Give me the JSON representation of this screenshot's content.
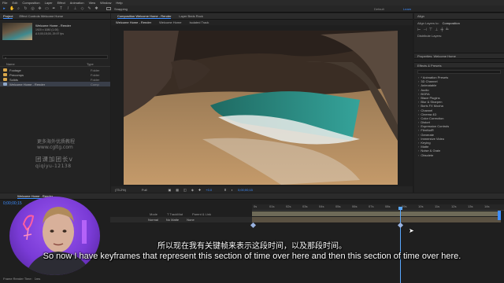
{
  "menu": [
    "File",
    "Edit",
    "Composition",
    "Layer",
    "Effect",
    "Animation",
    "View",
    "Window",
    "Help"
  ],
  "toolbar": {
    "snapping": "Snapping",
    "workspace_default": "Default",
    "workspace_learn": "Learn"
  },
  "project": {
    "tab": "Project",
    "effect_controls_tab": "Effect Controls Welcome Home",
    "selected_name": "Welcome Home - Render",
    "selected_info": "1920 x 1080 (1.00)",
    "selected_duration": "Δ 0;00;15;00, 29.97 fps",
    "col_name": "Name",
    "col_type": "Type",
    "items": [
      {
        "name": "Footage",
        "type": "Folder",
        "kind": "folder"
      },
      {
        "name": "Precomps",
        "type": "Folder",
        "kind": "folder"
      },
      {
        "name": "Solids",
        "type": "Folder",
        "kind": "folder"
      },
      {
        "name": "Welcome Home - Render",
        "type": "Comp",
        "kind": "comp"
      }
    ]
  },
  "composition": {
    "panel_tab": "Composition Welcome Home - Render",
    "layer_tab": "Layer Beds Rock",
    "view_tabs": [
      "Welcome Home - Render",
      "Welcome Home",
      "Isolated Track"
    ],
    "zoom": "(73.2%)",
    "resolution": "Full",
    "exposure": "+0.0",
    "timecode": "0;00;00;15"
  },
  "align": {
    "title": "Align",
    "align_layers_to": "Align Layers to:",
    "align_target": "Composition",
    "distribute": "Distribute Layers:"
  },
  "properties": {
    "title": "Properties: Welcome Home"
  },
  "effects_presets": {
    "title": "Effects & Presets",
    "items": [
      "* Animation Presets",
      "3D Channel",
      "Animatable",
      "Audio",
      "BGRA",
      "Blace Plugins",
      "Blur & Sharpen",
      "Boris FX Mocha",
      "Channel",
      "Cinema 4D",
      "Color Correction",
      "Distort",
      "Expression Controls",
      "FilmNoiR",
      "Generate",
      "Immersive Video",
      "Keying",
      "Matte",
      "Noise & Grain",
      "Obsolete"
    ]
  },
  "timeline": {
    "comp_tab": "Welcome Home - Render",
    "current_time": "0;00;00;15",
    "col_mode": "Mode",
    "col_trackmat": "T TrackMat",
    "col_parent": "Parent & Link",
    "row_mode": "Normal",
    "row_trackmat": "No Matte",
    "row_parent": "None",
    "ruler_labels": [
      "0s",
      "01s",
      "02s",
      "03s",
      "04s",
      "05s",
      "06s",
      "07s",
      "08s",
      "09s",
      "10s",
      "11s",
      "12s",
      "13s",
      "14s"
    ],
    "render_time_label": "Frame Render Time:",
    "render_time_value": "1ms"
  },
  "watermarks": {
    "line1": "更多海外优质教程",
    "line2": "www.cgltg.com",
    "line3": "团课加团长v",
    "line4": "qiqiyu-12138"
  },
  "subtitles": {
    "chinese": "所以现在我有关键帧来表示这段时间，以及那段时间。",
    "english": "So now I have keyframes that represent this section of time over here and then this section of time over here."
  },
  "colors": {
    "accent_blue": "#3d8dff",
    "folder_yellow": "#d8a64a",
    "timeline_bar": "#6e6a58",
    "playhead": "#5aa8ff",
    "webcam_bg": "#7a3bd6"
  }
}
